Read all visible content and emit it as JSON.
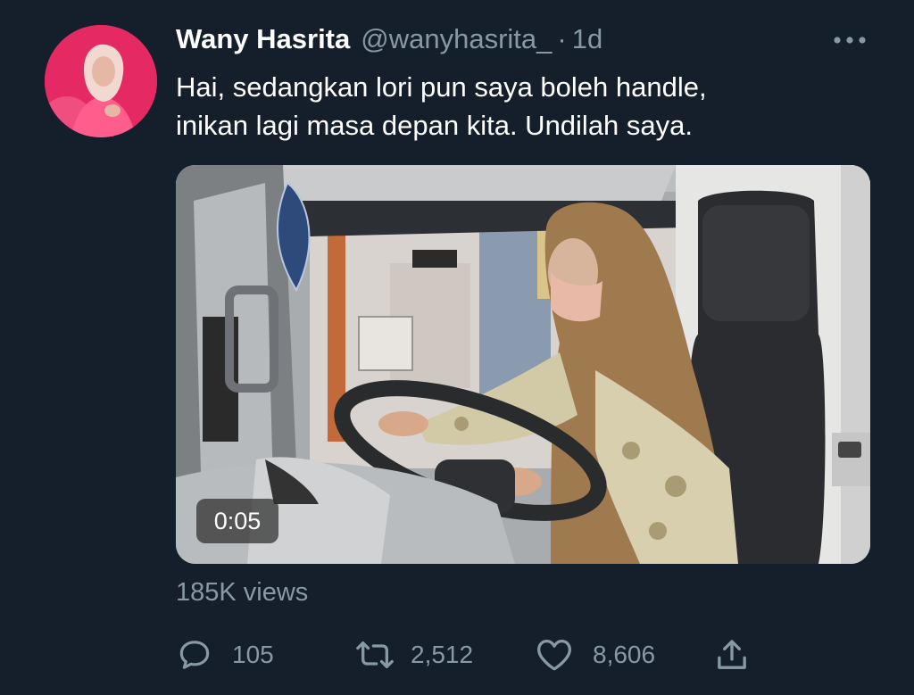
{
  "tweet": {
    "author": {
      "display_name": "Wany Hasrita",
      "handle": "@wanyhasrita_",
      "separator": "·",
      "time": "1d"
    },
    "text_lines": [
      "Hai, sedangkan lori pun saya boleh handle,",
      "inikan lagi masa depan kita. Undilah saya."
    ],
    "media": {
      "type": "video",
      "duration": "0:05"
    },
    "views": "185K views",
    "actions": {
      "reply_count": "105",
      "retweet_count": "2,512",
      "like_count": "8,606"
    }
  },
  "icons": {
    "more": "more-horizontal-icon",
    "reply": "reply-icon",
    "retweet": "retweet-icon",
    "like": "heart-icon",
    "share": "share-icon"
  },
  "colors": {
    "background": "#151f2b",
    "primary_text": "#ffffff",
    "secondary_text": "#8899a6",
    "avatar_bg": "#e0245e"
  }
}
